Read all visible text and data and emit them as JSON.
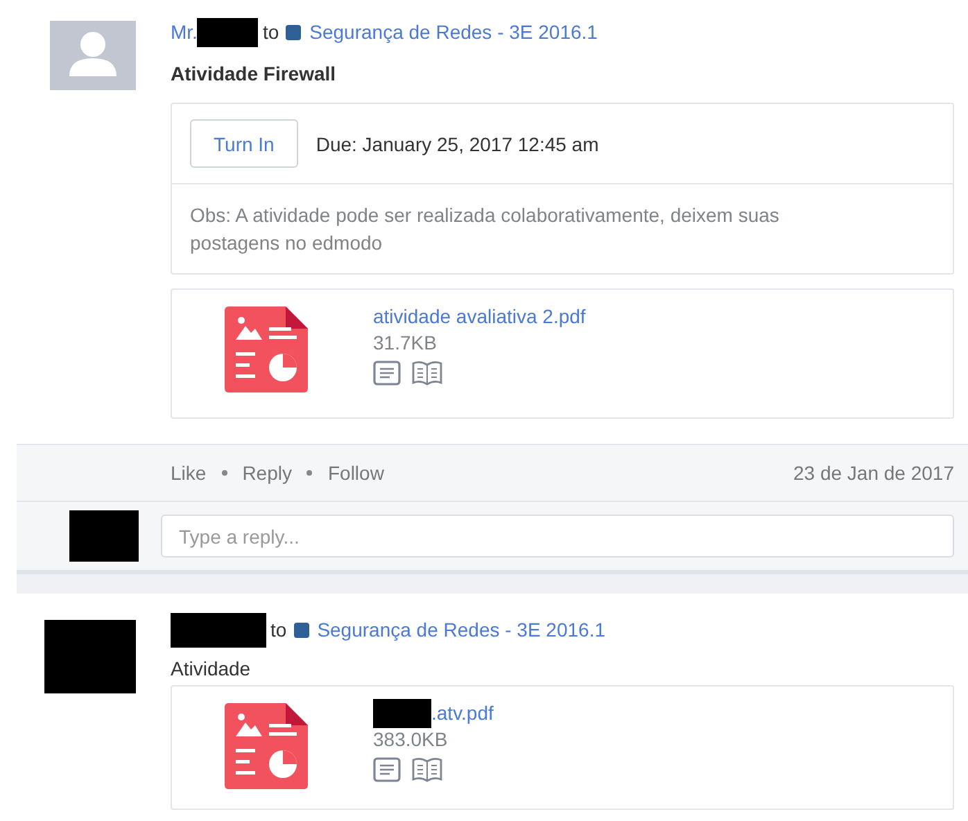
{
  "posts": [
    {
      "kind": "assignment",
      "avatar": {
        "kind": "silhouette"
      },
      "sender": "Mr.",
      "sender_redacted": true,
      "to": "to",
      "group": "Segurança de Redes - 3E 2016.1",
      "title": "Atividade Firewall",
      "turn_in": "Turn In",
      "due": "Due: January 25, 2017 12:45 am",
      "note": "Obs: A atividade pode ser realizada colaborativamente, deixem suas postagens no edmodo",
      "file": {
        "name": "atividade avaliativa 2.pdf",
        "name_redacted": false,
        "size": "31.7KB"
      },
      "actions": [
        "Like",
        "Reply",
        "Follow"
      ],
      "date": "23 de Jan de 2017",
      "reply_placeholder": "Type a reply..."
    },
    {
      "kind": "note",
      "avatar": {
        "kind": "redacted"
      },
      "sender_redacted": true,
      "to": "to",
      "group": "Segurança de Redes - 3E 2016.1",
      "title": "Atividade",
      "file": {
        "name": ".atv.pdf",
        "name_redacted": true,
        "size": "383.0KB"
      }
    }
  ]
}
